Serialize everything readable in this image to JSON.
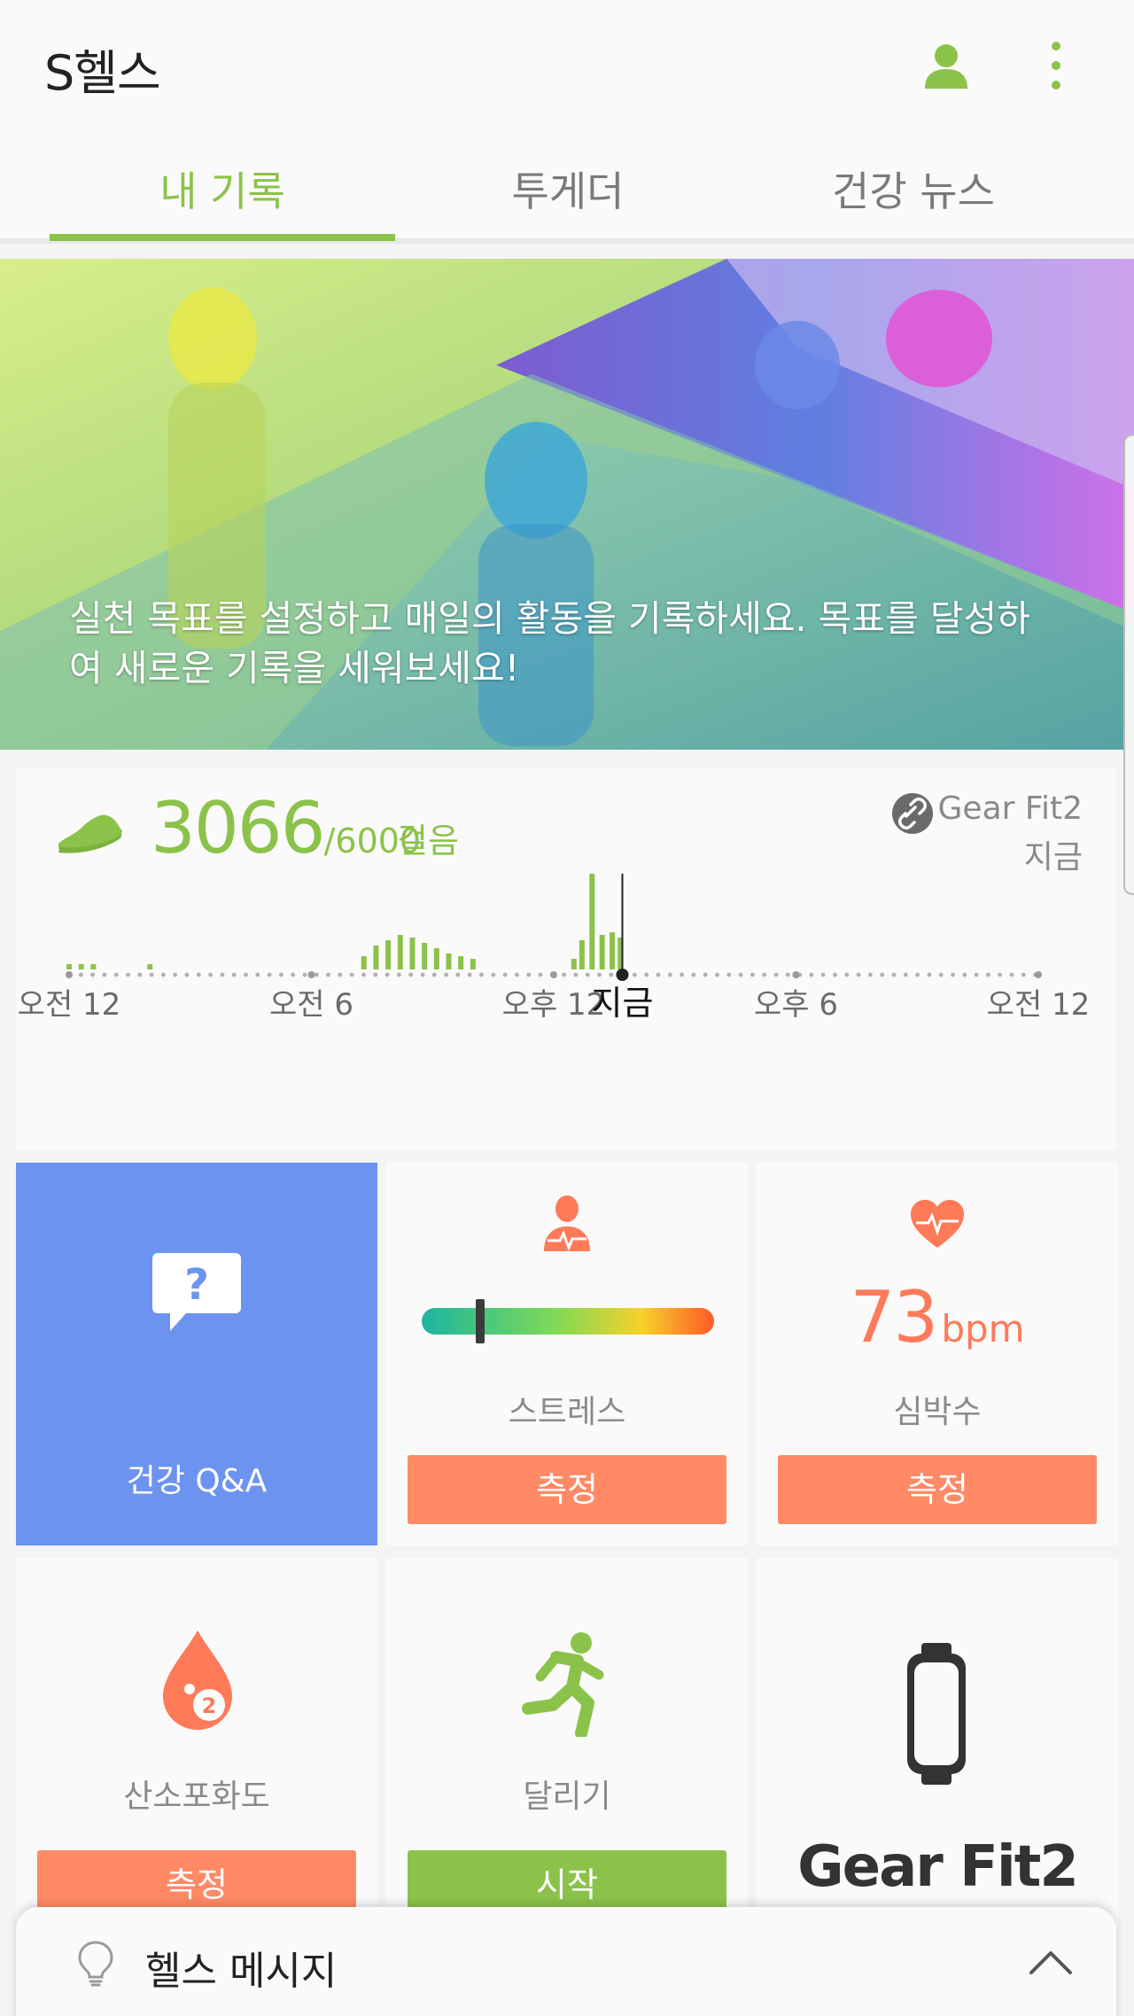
{
  "app": {
    "title": "S헬스"
  },
  "tabs": [
    {
      "label": "내 기록",
      "active": true
    },
    {
      "label": "투게더",
      "active": false
    },
    {
      "label": "건강 뉴스",
      "active": false
    }
  ],
  "banner": {
    "text": "실천 목표를 설정하고 매일의 활동을 기록하세요. 목표를 달성하여 새로운 기록을 세워보세요!"
  },
  "steps": {
    "value": "3066",
    "goal": "/6000",
    "unit": "걸음",
    "device_name": "Gear Fit2",
    "device_time": "지금",
    "time_labels": [
      "오전 12",
      "오전 6",
      "오후 12",
      "지금",
      "오후 6",
      "오전 12"
    ]
  },
  "chart_data": {
    "type": "bar",
    "x_range_hours": [
      0,
      24
    ],
    "now_hour": 13.7,
    "bars": [
      {
        "hour": 0.0,
        "value": 4
      },
      {
        "hour": 0.3,
        "value": 4
      },
      {
        "hour": 0.6,
        "value": 4
      },
      {
        "hour": 2.0,
        "value": 4
      },
      {
        "hour": 7.3,
        "value": 10
      },
      {
        "hour": 7.6,
        "value": 18
      },
      {
        "hour": 7.9,
        "value": 22
      },
      {
        "hour": 8.2,
        "value": 26
      },
      {
        "hour": 8.5,
        "value": 24
      },
      {
        "hour": 8.8,
        "value": 20
      },
      {
        "hour": 9.1,
        "value": 16
      },
      {
        "hour": 9.4,
        "value": 12
      },
      {
        "hour": 9.7,
        "value": 10
      },
      {
        "hour": 10.0,
        "value": 8
      },
      {
        "hour": 12.5,
        "value": 8
      },
      {
        "hour": 12.7,
        "value": 22
      },
      {
        "hour": 12.95,
        "value": 140
      },
      {
        "hour": 13.2,
        "value": 26
      },
      {
        "hour": 13.45,
        "value": 28
      },
      {
        "hour": 13.65,
        "value": 24
      }
    ],
    "colors": {
      "bar": "#8bc34a",
      "axis_dots": "#b0b0b0",
      "now_line": "#222222"
    }
  },
  "tiles": {
    "qa": {
      "label": "건강 Q&A",
      "icon": "question-bubble-icon"
    },
    "stress": {
      "label": "스트레스",
      "button": "측정",
      "level": 0.2
    },
    "heart_rate": {
      "label": "심박수",
      "value": "73",
      "unit": "bpm",
      "button": "측정"
    },
    "spo2": {
      "label": "산소포화도",
      "button": "측정"
    },
    "running": {
      "label": "달리기",
      "button": "시작"
    },
    "gear": {
      "logo": "Gear Fit2"
    }
  },
  "bottom_sheet": {
    "title": "헬스 메시지"
  },
  "colors": {
    "accent": "#8bc34a",
    "orange": "#ff8a65",
    "qa_blue": "#6c93f0"
  }
}
